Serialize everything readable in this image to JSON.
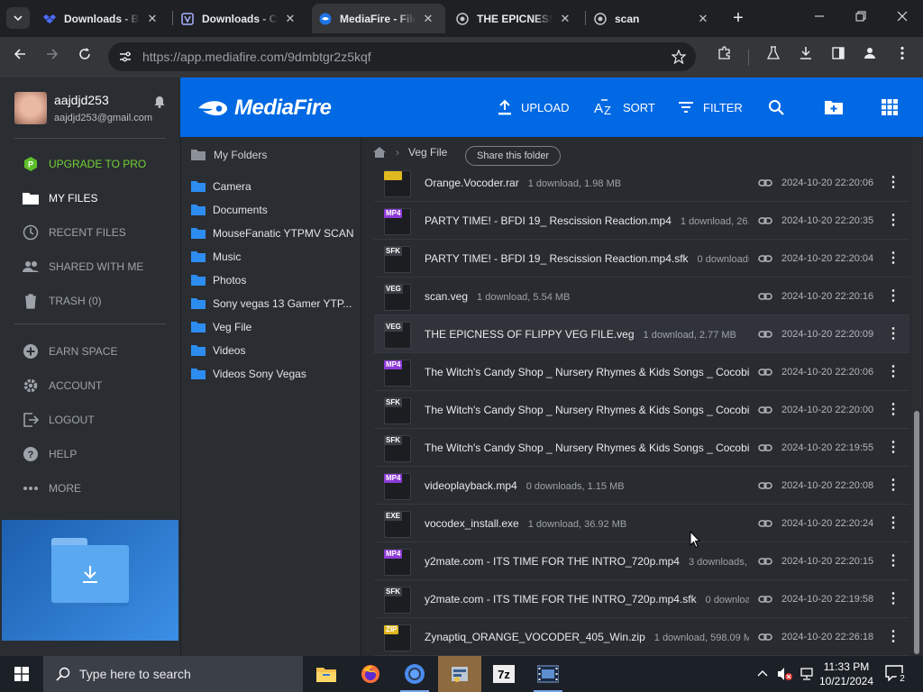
{
  "browser": {
    "tabs": [
      {
        "title": "Downloads - B",
        "close": "✕"
      },
      {
        "title": "Downloads - C",
        "close": "✕"
      },
      {
        "title": "MediaFire - File",
        "close": "✕"
      },
      {
        "title": "THE EPICNESS",
        "close": "✕"
      },
      {
        "title": "scan",
        "close": "✕"
      }
    ],
    "new_tab": "+",
    "url_host": "https://app.mediafire.com/",
    "url_path": "9dmbtgr2z5kqf"
  },
  "user": {
    "name": "aajdjd253",
    "email": "aajdjd253@gmail.com"
  },
  "sidebar": {
    "items": [
      {
        "label": "UPGRADE TO PRO"
      },
      {
        "label": "MY FILES"
      },
      {
        "label": "RECENT FILES"
      },
      {
        "label": "SHARED WITH ME"
      },
      {
        "label": "TRASH (0)"
      },
      {
        "label": "EARN SPACE"
      },
      {
        "label": "ACCOUNT"
      },
      {
        "label": "LOGOUT"
      },
      {
        "label": "HELP"
      },
      {
        "label": "MORE"
      }
    ]
  },
  "header": {
    "logo": "MediaFire",
    "upload": "UPLOAD",
    "sort": "SORT",
    "filter": "FILTER"
  },
  "tree": {
    "root": "My Folders",
    "folders": [
      "Camera",
      "Documents",
      "MouseFanatic YTPMV SCAN",
      "Music",
      "Photos",
      "Sony vegas 13 Gamer YTP...",
      "Veg File",
      "Videos",
      "Videos Sony Vegas"
    ]
  },
  "breadcrumb": {
    "current": "Veg File",
    "share": "Share this folder"
  },
  "files": [
    {
      "tag": "",
      "name": "Orange.Vocoder.rar",
      "meta": "1 download, 1.98 MB",
      "date": "2024-10-20 22:20:06"
    },
    {
      "tag": "MP4",
      "name": "PARTY TIME! - BFDI 19_ Rescission Reaction.mp4",
      "meta": "1 download, 26.",
      "date": "2024-10-20 22:20:35"
    },
    {
      "tag": "SFK",
      "name": "PARTY TIME! - BFDI 19_ Rescission Reaction.mp4.sfk",
      "meta": "0 downloads",
      "date": "2024-10-20 22:20:04"
    },
    {
      "tag": "VEG",
      "name": "scan.veg",
      "meta": "1 download, 5.54 MB",
      "date": "2024-10-20 22:20:16"
    },
    {
      "tag": "VEG",
      "name": "THE EPICNESS OF FLIPPY VEG FILE.veg",
      "meta": "1 download, 2.77 MB",
      "date": "2024-10-20 22:20:09"
    },
    {
      "tag": "MP4",
      "name": "The Witch's Candy Shop _ Nursery Rhymes & Kids Songs _ Cocobi",
      "meta": "",
      "date": "2024-10-20 22:20:06"
    },
    {
      "tag": "SFK",
      "name": "The Witch's Candy Shop _ Nursery Rhymes & Kids Songs _ Cocobi",
      "meta": "",
      "date": "2024-10-20 22:20:00"
    },
    {
      "tag": "SFK",
      "name": "The Witch's Candy Shop _ Nursery Rhymes & Kids Songs _ Cocobi",
      "meta": "",
      "date": "2024-10-20 22:19:55"
    },
    {
      "tag": "MP4",
      "name": "videoplayback.mp4",
      "meta": "0 downloads, 1.15 MB",
      "date": "2024-10-20 22:20:08"
    },
    {
      "tag": "EXE",
      "name": "vocodex_install.exe",
      "meta": "1 download, 36.92 MB",
      "date": "2024-10-20 22:20:24"
    },
    {
      "tag": "MP4",
      "name": "y2mate.com - ITS TIME FOR THE INTRO_720p.mp4",
      "meta": "3 downloads, :",
      "date": "2024-10-20 22:20:15"
    },
    {
      "tag": "SFK",
      "name": "y2mate.com - ITS TIME FOR THE INTRO_720p.mp4.sfk",
      "meta": "0 downloa",
      "date": "2024-10-20 22:19:58"
    },
    {
      "tag": "ZIP",
      "name": "Zynaptiq_ORANGE_VOCODER_405_Win.zip",
      "meta": "1 download, 598.09 M",
      "date": "2024-10-20 22:26:18"
    }
  ],
  "tag_colors": {
    "MP4": "#8c3ad6",
    "SFK": "#3c3f45",
    "VEG": "#3c3f45",
    "EXE": "#3c3f45",
    "ZIP": "#e0b81f",
    "": "#e0b81f"
  },
  "taskbar": {
    "search_placeholder": "Type here to search",
    "time": "11:33 PM",
    "date": "10/21/2024",
    "notifications": "2"
  }
}
